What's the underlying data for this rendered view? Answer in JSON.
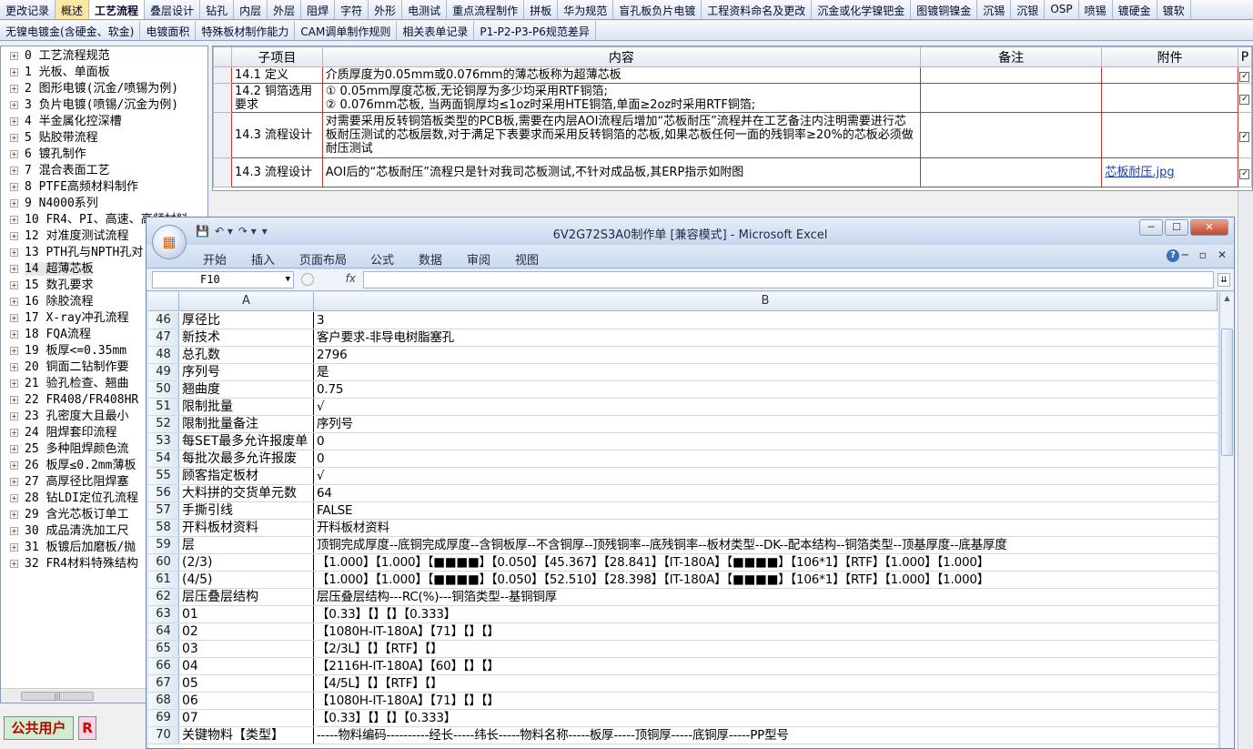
{
  "tabs_row1": [
    {
      "label": "更改记录",
      "state": ""
    },
    {
      "label": "概述",
      "state": "hl"
    },
    {
      "label": "工艺流程",
      "state": "sel"
    },
    {
      "label": "叠层设计",
      "state": ""
    },
    {
      "label": "钻孔",
      "state": ""
    },
    {
      "label": "内层",
      "state": ""
    },
    {
      "label": "外层",
      "state": ""
    },
    {
      "label": "阻焊",
      "state": ""
    },
    {
      "label": "字符",
      "state": ""
    },
    {
      "label": "外形",
      "state": ""
    },
    {
      "label": "电测试",
      "state": ""
    },
    {
      "label": "重点流程制作",
      "state": ""
    },
    {
      "label": "拼板",
      "state": ""
    },
    {
      "label": "华为规范",
      "state": ""
    },
    {
      "label": "盲孔板负片电镀",
      "state": ""
    },
    {
      "label": "工程资料命名及更改",
      "state": ""
    },
    {
      "label": "沉金或化学镍钯金",
      "state": ""
    },
    {
      "label": "图镀铜镍金",
      "state": ""
    },
    {
      "label": "沉锡",
      "state": ""
    },
    {
      "label": "沉银",
      "state": ""
    },
    {
      "label": "OSP",
      "state": ""
    },
    {
      "label": "喷锡",
      "state": ""
    },
    {
      "label": "镀硬金",
      "state": ""
    },
    {
      "label": "镀软",
      "state": ""
    }
  ],
  "tabs_row2": [
    {
      "label": "无镍电镀金(含硬金、软金)"
    },
    {
      "label": "电镀面积"
    },
    {
      "label": "特殊板材制作能力"
    },
    {
      "label": "CAM调单制作规则"
    },
    {
      "label": "相关表单记录"
    },
    {
      "label": "P1-P2-P3-P6规范差异"
    }
  ],
  "tree": [
    {
      "label": "0 工艺流程规范",
      "sel": false
    },
    {
      "label": "1 光板、单面板",
      "sel": false
    },
    {
      "label": "2 图形电镀(沉金/喷锡为例)",
      "sel": false
    },
    {
      "label": "3 负片电镀(喷锡/沉金为例)",
      "sel": false
    },
    {
      "label": "4 半金属化控深槽",
      "sel": false
    },
    {
      "label": "5 贴胶带流程",
      "sel": false
    },
    {
      "label": "6 镀孔制作",
      "sel": false
    },
    {
      "label": "7 混合表面工艺",
      "sel": false
    },
    {
      "label": "8 PTFE高频材料制作",
      "sel": false
    },
    {
      "label": "9 N4000系列",
      "sel": false
    },
    {
      "label": "10 FR4、PI、高速、高频材料",
      "sel": false
    },
    {
      "label": "12 对准度测试流程",
      "sel": false
    },
    {
      "label": "13 PTH孔与NPTH孔对",
      "sel": false
    },
    {
      "label": "14 超薄芯板",
      "sel": true
    },
    {
      "label": "15 数孔要求",
      "sel": false
    },
    {
      "label": "16 除胶流程",
      "sel": false
    },
    {
      "label": "17 X-ray冲孔流程",
      "sel": false
    },
    {
      "label": "18 FQA流程",
      "sel": false
    },
    {
      "label": "19 板厚<=0.35mm",
      "sel": false
    },
    {
      "label": "20 铜面二钻制作要",
      "sel": false
    },
    {
      "label": "21 验孔检查、翘曲",
      "sel": false
    },
    {
      "label": "22 FR408/FR408HR",
      "sel": false
    },
    {
      "label": "23 孔密度大且最小",
      "sel": false
    },
    {
      "label": "24 阻焊套印流程",
      "sel": false
    },
    {
      "label": "25 多种阻焊颜色流",
      "sel": false
    },
    {
      "label": "26 板厚≤0.2mm薄板",
      "sel": false
    },
    {
      "label": "27 高厚径比阻焊塞",
      "sel": false
    },
    {
      "label": "28 钻LDI定位孔流程",
      "sel": false
    },
    {
      "label": "29 含光芯板订单工",
      "sel": false
    },
    {
      "label": "30 成品清洗加工尺",
      "sel": false
    },
    {
      "label": "31 板镀后加磨板/抛",
      "sel": false
    },
    {
      "label": "32 FR4材料特殊结构",
      "sel": false
    }
  ],
  "tree_scroll_glyph": "|||",
  "status": {
    "user_label": "公共用户",
    "badge": "R"
  },
  "grid": {
    "headers": [
      "子项目",
      "内容",
      "备注",
      "附件",
      "P"
    ],
    "rows": [
      {
        "sub": "14.1 定义",
        "content": "介质厚度为0.05mm或0.076mm的薄芯板称为超薄芯板",
        "note": "",
        "attach": "",
        "checked": "✓"
      },
      {
        "sub": "14.2 铜箔选用要求",
        "content": "① 0.05mm厚度芯板,无论铜厚为多少均采用RTF铜箔;\n② 0.076mm芯板, 当两面铜厚均≤1oz时采用HTE铜箔,单面≥2oz时采用RTF铜箔;",
        "note": "",
        "attach": "",
        "checked": "✓"
      },
      {
        "sub": "14.3 流程设计",
        "content": "对需要采用反转铜箔板类型的PCB板,需要在内层AOI流程后增加“芯板耐压”流程并在工艺备注内注明需要进行芯板耐压测试的芯板层数,对于满足下表要求而采用反转铜箔的芯板,如果芯板任何一面的残铜率≥20%的芯板必须做耐压测试",
        "note": "",
        "attach": "",
        "checked": "✓"
      },
      {
        "sub": "14.3 流程设计",
        "content": "AOI后的“芯板耐压”流程只是针对我司芯板测试,不针对成品板,其ERP指示如附图",
        "note": "",
        "attach": "芯板耐压.jpg",
        "checked": "✓"
      }
    ]
  },
  "excel": {
    "title": "6V2G72S3A0制作单 [兼容模式] - Microsoft Excel",
    "qat": [
      "💾",
      "↶ ▾",
      "↷ ▾",
      "▾"
    ],
    "win_buttons": [
      "─",
      "☐",
      "✕"
    ],
    "ribbon_tabs": [
      "开始",
      "插入",
      "页面布局",
      "公式",
      "数据",
      "审阅",
      "视图"
    ],
    "help": "?",
    "mini_buttons": [
      "─",
      "▫",
      "✕"
    ],
    "namebox": "F10",
    "fx": "fx",
    "columns": [
      "A",
      "B"
    ],
    "rows": [
      {
        "n": "46",
        "a": "厚径比",
        "b": "3"
      },
      {
        "n": "47",
        "a": "新技术",
        "b": "客户要求-非导电树脂塞孔"
      },
      {
        "n": "48",
        "a": "总孔数",
        "b": "2796"
      },
      {
        "n": "49",
        "a": "序列号",
        "b": "是"
      },
      {
        "n": "50",
        "a": "翘曲度",
        "b": "0.75"
      },
      {
        "n": "51",
        "a": "限制批量",
        "b": "√"
      },
      {
        "n": "52",
        "a": "限制批量备注",
        "b": "序列号"
      },
      {
        "n": "53",
        "a": "每SET最多允许报废单",
        "b": "0"
      },
      {
        "n": "54",
        "a": "每批次最多允许报废",
        "b": "0"
      },
      {
        "n": "55",
        "a": "顾客指定板材",
        "b": "√"
      },
      {
        "n": "56",
        "a": "大料拼的交货单元数",
        "b": "64"
      },
      {
        "n": "57",
        "a": "手撕引线",
        "b": "FALSE"
      },
      {
        "n": "58",
        "a": "开料板材资料",
        "b": "开料板材资料"
      },
      {
        "n": "59",
        "a": "层",
        "b": "顶铜完成厚度--底铜完成厚度--含铜板厚--不含铜厚--顶残铜率--底残铜率--板材类型--DK--配本结构--铜箔类型--顶基厚度--底基厚度"
      },
      {
        "n": "60",
        "a": "(2/3)",
        "b": "【1.000】【1.000】【■■■■】【0.050】【45.367】【28.841】【IT-180A】【■■■■】【106*1】【RTF】【1.000】【1.000】"
      },
      {
        "n": "61",
        "a": "(4/5)",
        "b": "【1.000】【1.000】【■■■■】【0.050】【52.510】【28.398】【IT-180A】【■■■■】【106*1】【RTF】【1.000】【1.000】"
      },
      {
        "n": "62",
        "a": "层压叠层结构",
        "b": "层压叠层结构---RC(%)---铜箔类型--基铜铜厚"
      },
      {
        "n": "63",
        "a": "01",
        "b": "【0.33】【】【】【0.333】"
      },
      {
        "n": "64",
        "a": "02",
        "b": "【1080H-IT-180A】【71】【】【】"
      },
      {
        "n": "65",
        "a": "03",
        "b": "【2/3L】【】【RTF】【】"
      },
      {
        "n": "66",
        "a": "04",
        "b": "【2116H-IT-180A】【60】【】【】"
      },
      {
        "n": "67",
        "a": "05",
        "b": "【4/5L】【】【RTF】【】"
      },
      {
        "n": "68",
        "a": "06",
        "b": "【1080H-IT-180A】【71】【】【】"
      },
      {
        "n": "69",
        "a": "07",
        "b": "【0.33】【】【】【0.333】"
      },
      {
        "n": "70",
        "a": "关键物料【类型】",
        "b": "-----物料编码----------经长-----纬长-----物料名称-----板厚-----顶铜厚-----底铜厚-----PP型号"
      }
    ]
  }
}
